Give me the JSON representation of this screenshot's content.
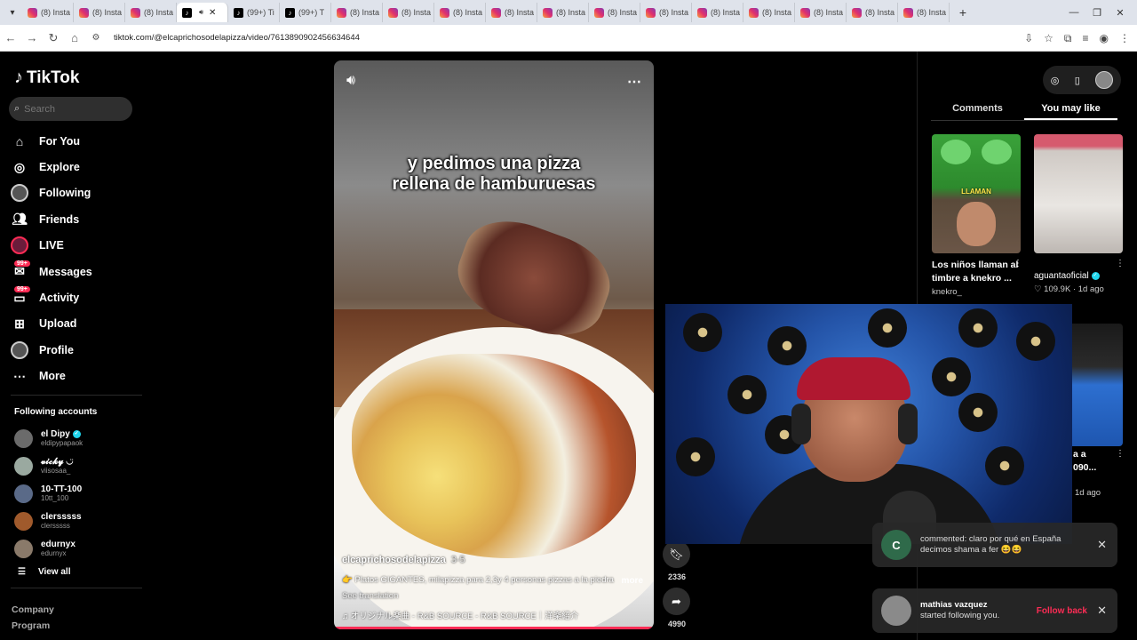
{
  "browser": {
    "tabs": [
      {
        "icon": "instagram",
        "label": "(8) Insta"
      },
      {
        "icon": "instagram",
        "label": "(8) Insta"
      },
      {
        "icon": "instagram",
        "label": "(8) Insta"
      },
      {
        "icon": "tiktok",
        "label": "",
        "active": true
      },
      {
        "icon": "tiktok",
        "label": "(99+) Ti"
      },
      {
        "icon": "tiktok",
        "label": "(99+) T"
      },
      {
        "icon": "instagram",
        "label": "(8) Insta"
      },
      {
        "icon": "instagram",
        "label": "(8) Insta"
      },
      {
        "icon": "instagram",
        "label": "(8) Insta"
      },
      {
        "icon": "instagram",
        "label": "(8) Insta"
      },
      {
        "icon": "instagram",
        "label": "(8) Insta"
      },
      {
        "icon": "instagram",
        "label": "(8) Insta"
      },
      {
        "icon": "instagram",
        "label": "(8) Insta"
      },
      {
        "icon": "instagram",
        "label": "(8) Insta"
      },
      {
        "icon": "instagram",
        "label": "(8) Insta"
      },
      {
        "icon": "instagram",
        "label": "(8) Insta"
      },
      {
        "icon": "instagram",
        "label": "(8) Insta"
      },
      {
        "icon": "instagram",
        "label": "(8) Insta"
      }
    ],
    "url": "tiktok.com/@elcaprichosodelapizza/video/7613890902456634644"
  },
  "sidebar": {
    "logo": "TikTok",
    "search_placeholder": "Search",
    "nav": [
      {
        "label": "For You",
        "icon": "home-icon"
      },
      {
        "label": "Explore",
        "icon": "compass-icon"
      },
      {
        "label": "Following",
        "icon": "avatar-icon"
      },
      {
        "label": "Friends",
        "icon": "friends-icon"
      },
      {
        "label": "LIVE",
        "icon": "live-icon"
      },
      {
        "label": "Messages",
        "icon": "messages-icon",
        "badge": "99+"
      },
      {
        "label": "Activity",
        "icon": "activity-icon",
        "badge": "99+"
      },
      {
        "label": "Upload",
        "icon": "upload-icon"
      },
      {
        "label": "Profile",
        "icon": "profile-icon"
      },
      {
        "label": "More",
        "icon": "more-icon"
      }
    ],
    "following_title": "Following accounts",
    "accounts": [
      {
        "name": "el Dipy",
        "handle": "eldipypapaok",
        "verified": true
      },
      {
        "name": "𝓿𝓲𝓬𝓴𝔂 ◡̈",
        "handle": "viisosaa_"
      },
      {
        "name": "10-TT-100",
        "handle": "10tt_100"
      },
      {
        "name": "clersssss",
        "handle": "clersssss"
      },
      {
        "name": "edurnyx",
        "handle": "edurnyx"
      }
    ],
    "view_all": "View all",
    "footer": [
      "Company",
      "Program"
    ]
  },
  "video": {
    "caption_line1": "y pedimos una pizza",
    "caption_line2": "rellena de hamburuesas",
    "author": "elcaprichosodelapizza",
    "date": "3-5",
    "description": "👉 Platos GIGANTES, milapizza para 2,3y 4 personas pizzas a la piedra",
    "more": "more",
    "translation": "See translation",
    "music": "♫  オリジナル楽曲 - R&B SOURCE - R&B SOURCE｜洋楽紹介"
  },
  "actions": [
    {
      "icon": "bookmark-icon",
      "count": "2336"
    },
    {
      "icon": "share-icon",
      "count": "4990"
    }
  ],
  "right_panel": {
    "tabs": [
      "Comments",
      "You may like"
    ],
    "active_tab": "You may like",
    "cards": [
      {
        "title_line1": "Los niños llaman al",
        "title_line2": "timbre a knekro ...",
        "author": "knekro_",
        "overlay_text": "LLAMAN"
      },
      {
        "author": "aguantaoficial",
        "likes": "109.9K",
        "age": "1d ago"
      },
      {
        "partial_text_1": "a a",
        "partial_text_2": "090...",
        "age": "1d ago"
      }
    ]
  },
  "notifications": [
    {
      "avatar": "C",
      "text": "commented: claro por qué en España decimos shama a fer 😆😆"
    },
    {
      "name": "mathias vazquez",
      "text": "started following you.",
      "action": "Follow back"
    }
  ]
}
